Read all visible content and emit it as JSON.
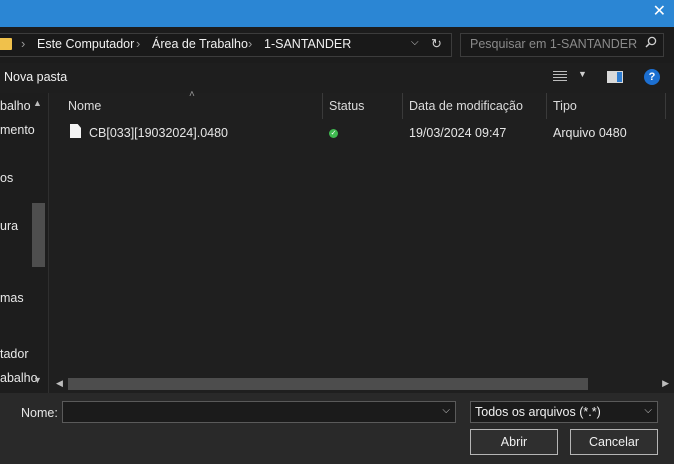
{
  "window": {
    "close_glyph": "✕"
  },
  "address": {
    "crumbs": [
      "Este Computador",
      "Área de Trabalho",
      "1-SANTANDER"
    ],
    "separator": "›",
    "refresh_glyph": "↻"
  },
  "search": {
    "placeholder": "Pesquisar em 1-SANTANDER"
  },
  "toolbar": {
    "new_folder_label": "Nova pasta",
    "help_glyph": "?"
  },
  "nav": {
    "items": [
      "balho",
      "mento",
      "os",
      "ura",
      "mas",
      "tador",
      "abalho"
    ]
  },
  "columns": [
    "Nome",
    "Status",
    "Data de modificação",
    "Tipo"
  ],
  "files": [
    {
      "name": "CB[033][19032024].0480",
      "status": "ok",
      "modified": "19/03/2024 09:47",
      "type": "Arquivo 0480"
    }
  ],
  "footer": {
    "name_label": "Nome:",
    "name_value": "",
    "filter_label": "Todos os arquivos (*.*)",
    "open_label": "Abrir",
    "cancel_label": "Cancelar"
  },
  "colors": {
    "titlebar": "#2b86d4",
    "status_ok": "#3fb950",
    "help": "#1c6fd1"
  },
  "icons": [
    "close-icon",
    "folder-icon",
    "chevron-down-icon",
    "refresh-icon",
    "search-icon",
    "view-options-icon",
    "preview-pane-icon",
    "help-icon",
    "file-icon",
    "status-ok-icon"
  ]
}
